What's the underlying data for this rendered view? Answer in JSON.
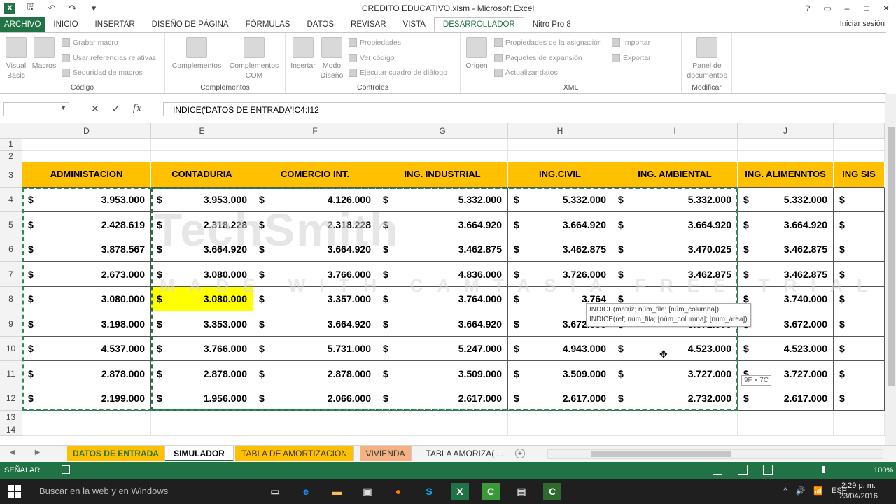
{
  "window": {
    "title": "CREDITO EDUCATIVO.xlsm - Microsoft Excel",
    "controls": [
      "?",
      "▭",
      "–",
      "□",
      "✕"
    ]
  },
  "ribbon_tabs": [
    "ARCHIVO",
    "INICIO",
    "INSERTAR",
    "DISEÑO DE PÁGINA",
    "FÓRMULAS",
    "DATOS",
    "REVISAR",
    "VISTA",
    "DESARROLLADOR",
    "Nitro Pro 8"
  ],
  "active_tab": "DESARROLLADOR",
  "signin": "Iniciar sesión",
  "ribbon": {
    "codigo": {
      "label": "Código",
      "visual_basic": "Visual\nBasic",
      "macros": "Macros",
      "grabar": "Grabar macro",
      "referencias": "Usar referencias relativas",
      "seguridad": "Seguridad de macros"
    },
    "complementos": {
      "label": "Complementos",
      "complementos": "Complementos",
      "com": "Complementos\nCOM"
    },
    "controles": {
      "label": "Controles",
      "insertar": "Insertar",
      "modo": "Modo\nDiseño",
      "propiedades": "Propiedades",
      "ver_codigo": "Ver código",
      "ejecutar": "Ejecutar cuadro de diálogo"
    },
    "xml": {
      "label": "XML",
      "origen": "Origen",
      "prop_asig": "Propiedades de la asignación",
      "paquetes": "Paquetes de expansión",
      "actualizar": "Actualizar datos",
      "importar": "Importar",
      "exportar": "Exportar"
    },
    "modificar": {
      "label": "Modificar",
      "panel": "Panel de\ndocumentos"
    }
  },
  "formula_bar": {
    "name_box": "",
    "cancel": "✕",
    "enter": "✓",
    "fx": "fx",
    "formula": "=INDICE('DATOS DE ENTRADA'!C4:I12"
  },
  "columns": [
    "D",
    "E",
    "F",
    "G",
    "H",
    "I",
    "J",
    ""
  ],
  "rows": [
    "1",
    "2",
    "3",
    "4",
    "5",
    "6",
    "7",
    "8",
    "9",
    "10",
    "11",
    "12",
    "13",
    "14"
  ],
  "headers": [
    "ADMINISTACION",
    "CONTADURIA",
    "COMERCIO INT.",
    "ING. INDUSTRIAL",
    "ING.CIVIL",
    "ING. AMBIENTAL",
    "ING. ALIMENNTOS",
    "ING SIS"
  ],
  "currency": "$",
  "table": [
    [
      "3.953.000",
      "3.953.000",
      "4.126.000",
      "5.332.000",
      "5.332.000",
      "5.332.000",
      "5.332.000",
      ""
    ],
    [
      "2.428.619",
      "2.318.228",
      "2.318.228",
      "3.664.920",
      "3.664.920",
      "3.664.920",
      "3.664.920",
      ""
    ],
    [
      "3.878.567",
      "3.664.920",
      "3.664.920",
      "3.462.875",
      "3.462.875",
      "3.470.025",
      "3.462.875",
      ""
    ],
    [
      "2.673.000",
      "3.080.000",
      "3.766.000",
      "4.836.000",
      "3.726.000",
      "3.462.875",
      "3.462.875",
      ""
    ],
    [
      "3.080.000",
      "3.080.000",
      "3.357.000",
      "3.764.000",
      "3.764",
      "",
      "3.740.000",
      ""
    ],
    [
      "3.198.000",
      "3.353.000",
      "3.664.920",
      "3.664.920",
      "3.672.000",
      "3.672.000",
      "3.672.000",
      ""
    ],
    [
      "4.537.000",
      "3.766.000",
      "5.731.000",
      "5.247.000",
      "4.943.000",
      "4.523.000",
      "4.523.000",
      ""
    ],
    [
      "2.878.000",
      "2.878.000",
      "2.878.000",
      "3.509.000",
      "3.509.000",
      "3.727.000",
      "3.727.000",
      ""
    ],
    [
      "2.199.000",
      "1.956.000",
      "2.066.000",
      "2.617.000",
      "2.617.000",
      "2.732.000",
      "2.617.000",
      ""
    ]
  ],
  "tooltip": {
    "line1": "INDICE(matriz; núm_fila; [núm_columna])",
    "line2": "INDICE(ref; núm_fila; [núm_columna]; [núm_área])"
  },
  "size_tip": "9F x 7C",
  "watermark": {
    "line1": "TechSmith",
    "line2": "MADE WITH CAMTASIA FREE TRIAL"
  },
  "sheet_tabs": [
    {
      "label": "DATOS DE ENTRADA",
      "color": "#ffc000"
    },
    {
      "label": "SIMULADOR",
      "color": "#ffffff"
    },
    {
      "label": "TABLA DE AMORTIZACION",
      "color": "#ffc000"
    },
    {
      "label": "VIVIENDA",
      "color": "#f4b183"
    },
    {
      "label": "TABLA AMORIZA( ...",
      "color": "#f3f3f3"
    }
  ],
  "status": {
    "ready": "SEÑALAR",
    "zoom": "100%"
  },
  "taskbar": {
    "search": "Buscar en la web y en Windows",
    "lang": "ESP",
    "time": "2:29 p. m.",
    "date": "23/04/2016"
  },
  "colors": {
    "excel_green": "#217346",
    "header_fill": "#ffc000",
    "highlight": "#ffff00"
  }
}
